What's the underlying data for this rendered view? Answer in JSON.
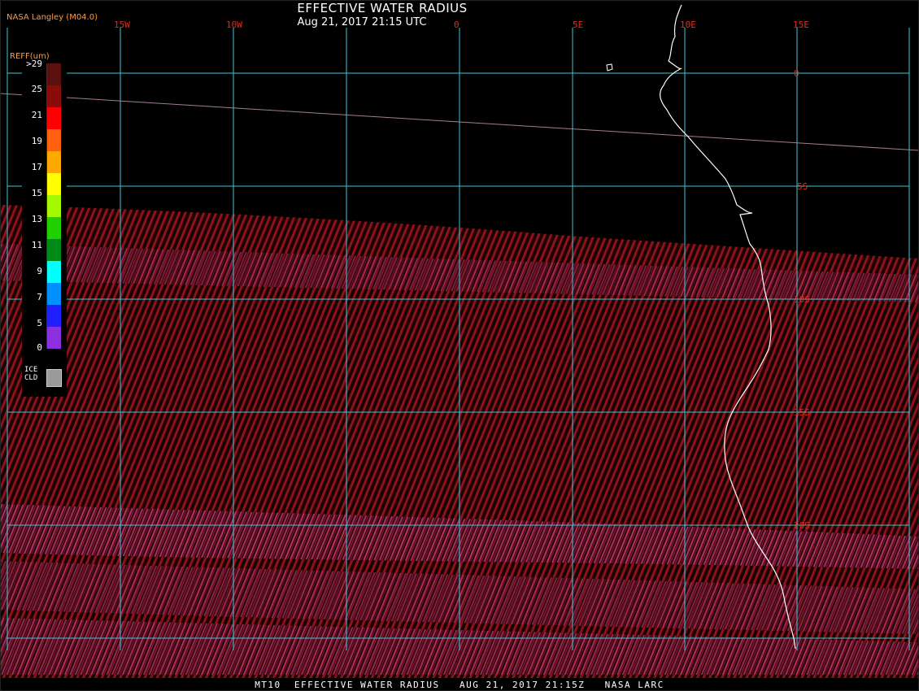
{
  "header": {
    "title": "EFFECTIVE WATER RADIUS",
    "subtitle": "Aug 21, 2017 21:15 UTC",
    "credit": "NASA Langley (M04.0)"
  },
  "footer": {
    "text": "MT10  EFFECTIVE WATER RADIUS   AUG 21, 2017 21:15Z   NASA LARC"
  },
  "map": {
    "lon_labels": [
      "15W",
      "10W",
      "0",
      "5E",
      "10E",
      "15E"
    ],
    "lat_labels": [
      "0",
      "5S",
      "10S",
      "15S",
      "20S"
    ],
    "colors": {
      "gridline": "#3fc6d6",
      "label": "#e52b1a",
      "coastline": "#ffffff",
      "cloud_dark": "#6e0d10",
      "cloud_mid": "#9b1420"
    }
  },
  "legend": {
    "title": "REFF(um)",
    "labels": [
      ">29",
      "25",
      "21",
      "19",
      "17",
      "15",
      "13",
      "11",
      "9",
      "7",
      "5",
      "0"
    ],
    "colors": [
      "#5c0f0f",
      "#8b0a0a",
      "#ff0000",
      "#ff6010",
      "#ffa800",
      "#ffff00",
      "#a4f800",
      "#20d000",
      "#008a18",
      "#00ffff",
      "#0090ff",
      "#2020ff",
      "#8a30e0"
    ],
    "ice_label_line1": "ICE",
    "ice_label_line2": "CLD",
    "ice_color": "#9a9a9a"
  }
}
